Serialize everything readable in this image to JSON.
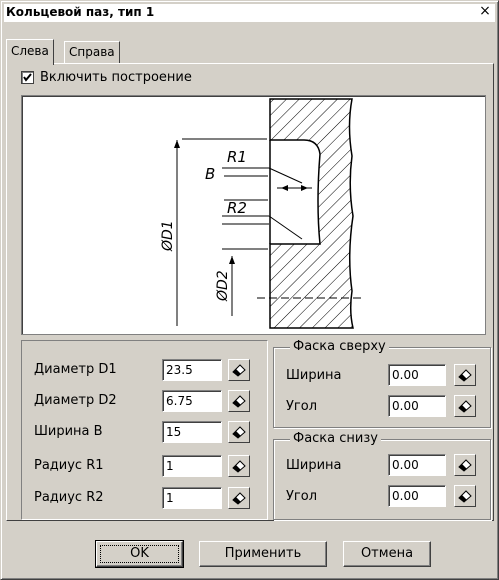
{
  "window": {
    "title": "Кольцевой паз, тип 1",
    "close_glyph": "×"
  },
  "tabs": [
    {
      "label": "Слева",
      "active": true
    },
    {
      "label": "Справа",
      "active": false
    }
  ],
  "enable_build": {
    "label": "Включить построение",
    "checked": true
  },
  "drawing": {
    "labels": {
      "r1": "R1",
      "b": "B",
      "r2": "R2",
      "d1": "ØD1",
      "d2": "ØD2"
    }
  },
  "params": {
    "d1": {
      "label": "Диаметр D1",
      "value": "23.5"
    },
    "d2": {
      "label": "Диаметр D2",
      "value": "6.75"
    },
    "b": {
      "label": "Ширина B",
      "value": "15"
    },
    "r1": {
      "label": "Радиус R1",
      "value": "1"
    },
    "r2": {
      "label": "Радиус R2",
      "value": "1"
    }
  },
  "chamfer_top": {
    "title": "Фаска сверху",
    "width": {
      "label": "Ширина",
      "value": "0.00"
    },
    "angle": {
      "label": "Угол",
      "value": "0.00"
    }
  },
  "chamfer_bottom": {
    "title": "Фаска снизу",
    "width": {
      "label": "Ширина",
      "value": "0.00"
    },
    "angle": {
      "label": "Угол",
      "value": "0.00"
    }
  },
  "buttons": {
    "ok": "OK",
    "apply": "Применить",
    "cancel": "Отмена"
  },
  "icons": {
    "pick": "eraser-pick-icon",
    "check": "check-icon",
    "close": "close-icon"
  }
}
